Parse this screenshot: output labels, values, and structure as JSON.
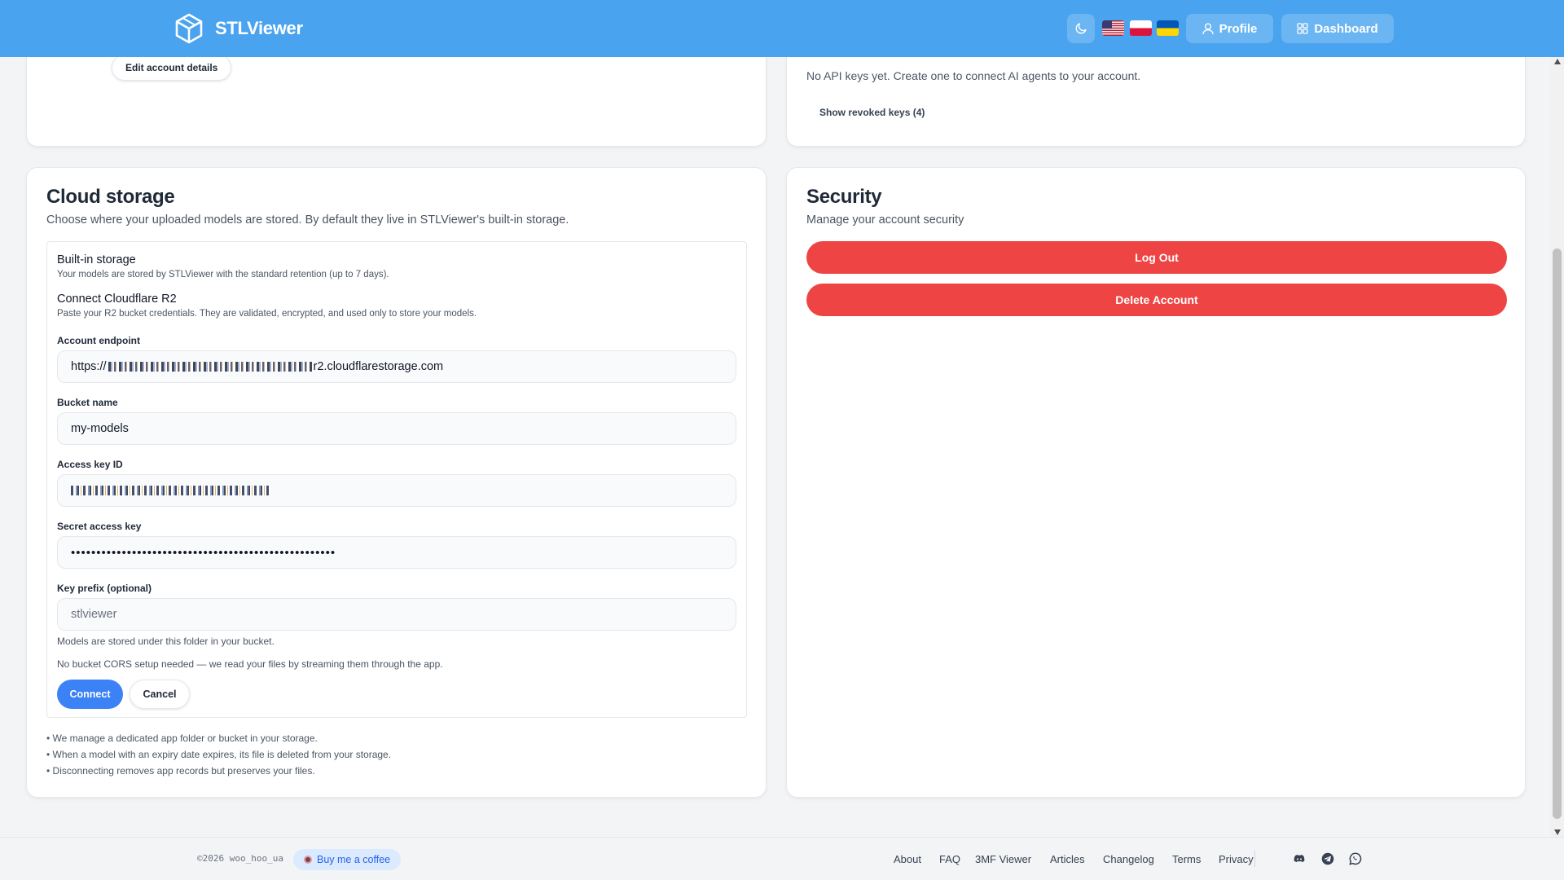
{
  "header": {
    "brand": "STLViewer",
    "profile_label": "Profile",
    "dashboard_label": "Dashboard",
    "languages": [
      "en-US",
      "pl",
      "uk"
    ]
  },
  "account": {
    "edit_button": "Edit account details"
  },
  "api_keys": {
    "empty_text": "No API keys yet. Create one to connect AI agents to your account.",
    "show_revoked": "Show revoked keys (4)"
  },
  "cloud": {
    "title": "Cloud storage",
    "subtitle": "Choose where your uploaded models are stored. By default they live in STLViewer's built-in storage.",
    "builtin_title": "Built-in storage",
    "builtin_desc": "Your models are stored by STLViewer with the standard retention (up to 7 days).",
    "r2_title": "Connect Cloudflare R2",
    "r2_desc": "Paste your R2 bucket credentials. They are validated, encrypted, and used only to store your models.",
    "endpoint_label": "Account endpoint",
    "endpoint_prefix": "https://",
    "endpoint_suffix": "r2.cloudflarestorage.com",
    "bucket_label": "Bucket name",
    "bucket_value": "my-models",
    "access_key_label": "Access key ID",
    "secret_label": "Secret access key",
    "secret_value": "••••••••••••••••••••••••••••••••••••••••••••••••••••",
    "prefix_label": "Key prefix (optional)",
    "prefix_placeholder": "stlviewer",
    "prefix_help": "Models are stored under this folder in your bucket.",
    "cors_note": "No bucket CORS setup needed — we read your files by streaming them through the app.",
    "connect_label": "Connect",
    "cancel_label": "Cancel",
    "bullets": [
      "• We manage a dedicated app folder or bucket in your storage.",
      "• When a model with an expiry date expires, its file is deleted from your storage.",
      "• Disconnecting removes app records but preserves your files."
    ]
  },
  "security": {
    "title": "Security",
    "subtitle": "Manage your account security",
    "logout_label": "Log Out",
    "delete_label": "Delete Account"
  },
  "footer": {
    "copyright": "©2026 woo_hoo_ua",
    "coffee": "Buy me a coffee",
    "links": [
      "About",
      "FAQ",
      "3MF Viewer",
      "Articles",
      "Changelog",
      "Terms",
      "Privacy"
    ],
    "social": [
      "discord-icon",
      "telegram-icon",
      "whatsapp-icon"
    ]
  },
  "colors": {
    "header": "#4aa3ef",
    "primary": "#3b82f6",
    "danger": "#ef4444"
  }
}
